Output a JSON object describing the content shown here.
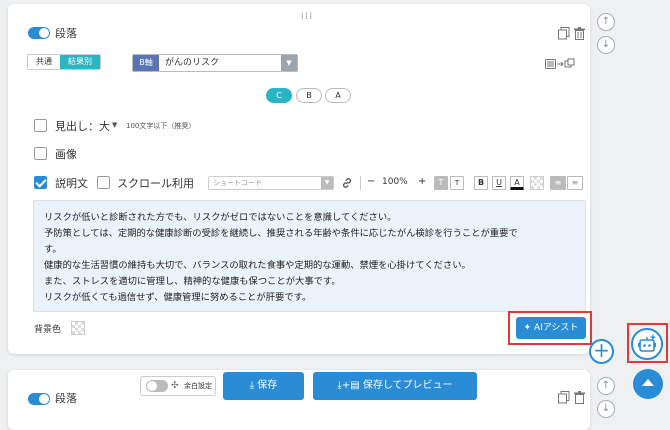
{
  "block": {
    "section_label": "段落",
    "tabs": [
      "共通",
      "結果別"
    ],
    "axis_tag": "B軸",
    "axis_value": "がんのリスク",
    "variants": [
      "C",
      "B",
      "A"
    ],
    "heading_label": "見出し：大",
    "heading_note": "100文字以下（推奨）",
    "image_label": "画像",
    "description_label": "説明文",
    "scroll_label": "スクロール利用",
    "shortcode_placeholder": "ショートコード",
    "font_size": "100%",
    "fmt_minus": "−",
    "fmt_plus": "+",
    "fmt_buttons": [
      "T",
      "T",
      "B",
      "U",
      "A"
    ],
    "body_lines": [
      "リスクが低いと診断された方でも、リスクがゼロではないことを意識してください。",
      "予防策としては、定期的な健康診断の受診を継続し、推奨される年齢や条件に応じたがん検診を行うことが重要で",
      "す。",
      "健康的な生活習慣の維持も大切で、バランスの取れた食事や定期的な運動、禁煙を心掛けてください。",
      "また、ストレスを適切に管理し、精神的な健康も保つことが大事です。",
      "リスクが低くても過信せず、健康管理に努めることが肝要です。"
    ],
    "bg_color_label": "背景色",
    "ai_assist_label": "AIアシスト"
  },
  "next_block": {
    "section_label": "段落"
  },
  "bottom_bar": {
    "margin_label": "余白設定",
    "save_label": "保存",
    "save_preview_label": "保存してプレビュー"
  },
  "colors": {
    "accent": "#2b8cd6",
    "teal": "#2bb5c4",
    "highlight": "#e53935"
  }
}
